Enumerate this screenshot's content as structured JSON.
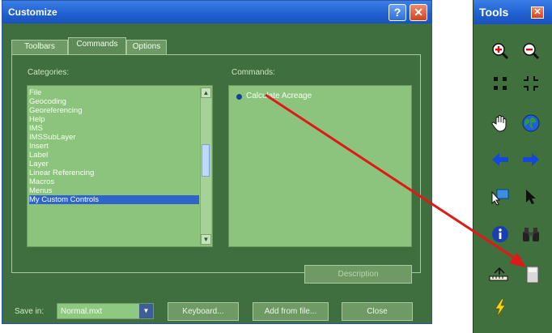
{
  "dialog": {
    "title": "Customize",
    "help_glyph": "?",
    "close_glyph": "✕",
    "tabs": [
      {
        "label": "Toolbars"
      },
      {
        "label": "Commands"
      },
      {
        "label": "Options"
      }
    ],
    "categories_label": "Categories:",
    "commands_label": "Commands:",
    "categories": [
      "File",
      "Geocoding",
      "Georeferencing",
      "Help",
      "IMS",
      "IMSSubLayer",
      "Insert",
      "Label",
      "Layer",
      "Linear Referencing",
      "Macros",
      "Menus",
      "My Custom Controls"
    ],
    "selected_category": "My Custom Controls",
    "commands": [
      {
        "label": "Calculate Acreage",
        "icon": "radio-dot-icon"
      }
    ],
    "describe_button": "Description",
    "save_in_label": "Save in:",
    "save_in_value": "Normal.mxt",
    "keyboard_button": "Keyboard...",
    "add_from_file_button": "Add from file...",
    "close_button": "Close"
  },
  "tools": {
    "title": "Tools",
    "close_glyph": "✕",
    "icons": [
      "zoom-in-icon",
      "zoom-out-icon",
      "fixed-zoom-in-icon",
      "fixed-zoom-out-icon",
      "pan-hand-icon",
      "full-extent-globe-icon",
      "back-arrow-icon",
      "forward-arrow-icon",
      "select-features-icon",
      "select-elements-pointer-icon",
      "identify-icon",
      "find-binoculars-icon",
      "measure-icon",
      "custom-command-icon",
      "hyperlink-lightning-icon"
    ]
  },
  "colors": {
    "title_blue": "#1f5fd0",
    "dialog_green": "#3f6e3f",
    "list_green": "#8cc47e",
    "selection_blue": "#2f64c8",
    "arrow_red": "#e01818"
  }
}
